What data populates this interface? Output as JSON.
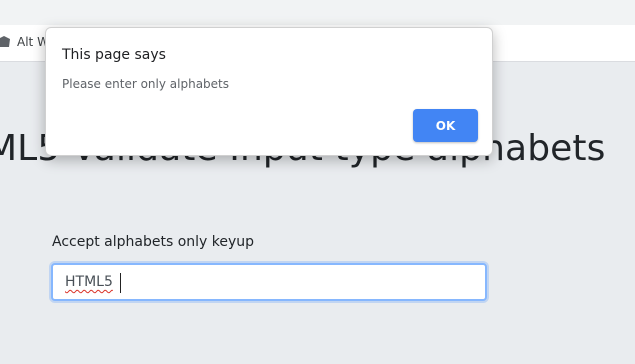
{
  "browser": {
    "bookmark": {
      "icon": "bookmark-icon",
      "label": "Alt W"
    }
  },
  "page": {
    "heading": "ML5 Validate Input type alphabets",
    "field_label": "Accept alphabets only keyup",
    "input_value": "HTML5"
  },
  "dialog": {
    "title": "This page says",
    "message": "Please enter only alphabets",
    "ok_label": "OK"
  },
  "colors": {
    "page_background": "#e9ecef",
    "ok_button": "#4285f4",
    "input_focus_border": "#86b7fe"
  }
}
